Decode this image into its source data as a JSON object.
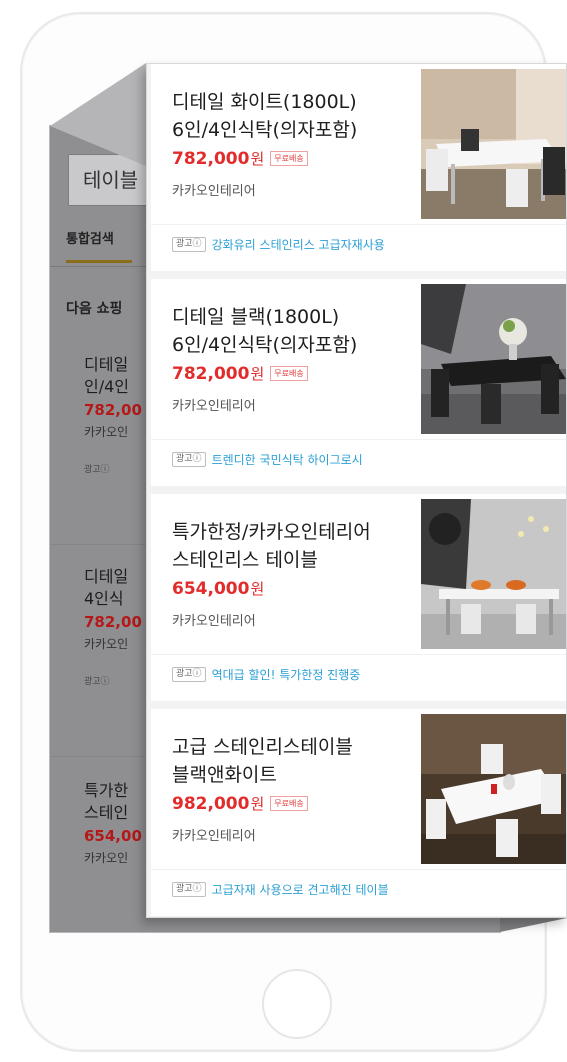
{
  "background": {
    "search_text": "테이블",
    "tab_label": "통합검색",
    "section_title": "다음 쇼핑",
    "items": [
      {
        "title1": "디테일",
        "title2": "인/4인",
        "price": "782,00",
        "seller": "카카오인",
        "ad": "광고ⓘ"
      },
      {
        "title1": "디테일",
        "title2": "4인식",
        "price": "782,00",
        "seller": "카카오인",
        "ad": "광고ⓘ"
      },
      {
        "title1": "특가한",
        "title2": "스테인",
        "price": "654,00",
        "seller": "카카오인",
        "ad": ""
      }
    ]
  },
  "products": [
    {
      "title": "디테일 화이트(1800L) 6인/4인식탁(의자포함)",
      "price": "782,000",
      "won": "원",
      "free_shipping": "무료배송",
      "seller": "카카오인테리어",
      "ad_tag": "광고ⓘ",
      "ad_text": "강화유리 스테인리스 고급자재사용"
    },
    {
      "title": "디테일 블랙(1800L) 6인/4인식탁(의자포함)",
      "price": "782,000",
      "won": "원",
      "free_shipping": "무료배송",
      "seller": "카카오인테리어",
      "ad_tag": "광고ⓘ",
      "ad_text": "트렌디한 국민식탁 하이그로시"
    },
    {
      "title": "특가한정/카카오인테리어 스테인리스 테이블",
      "price": "654,000",
      "won": "원",
      "free_shipping": "",
      "seller": "카카오인테리어",
      "ad_tag": "광고ⓘ",
      "ad_text": "역대급 할인! 특가한정 진행중"
    },
    {
      "title": "고급 스테인리스테이블 블랙앤화이트",
      "price": "982,000",
      "won": "원",
      "free_shipping": "무료배송",
      "seller": "카카오인테리어",
      "ad_tag": "광고ⓘ",
      "ad_text": "고급자재 사용으로 견고해진 테이블"
    }
  ],
  "colors": {
    "price": "#e22c2c",
    "ad_text": "#2a9fd6",
    "overlay": "#8f8f92"
  }
}
